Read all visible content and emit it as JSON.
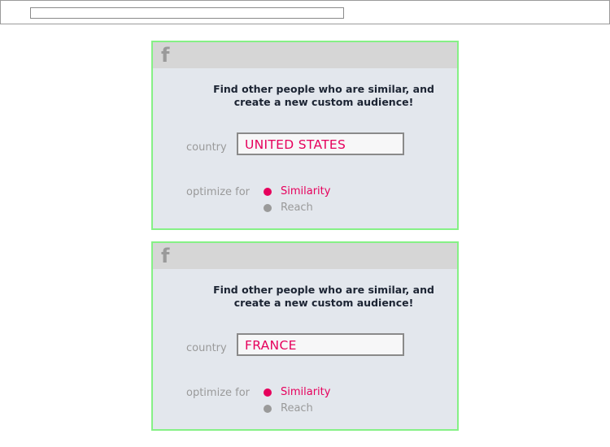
{
  "colors": {
    "accent": "#e6005c",
    "muted": "#9a9a9a",
    "card_border": "#86f086",
    "card_bg": "#e3e7ed"
  },
  "cards": [
    {
      "icon": "facebook-icon",
      "icon_glyph": "f",
      "headline_line1": "Find other people who are similar, and",
      "headline_line2": "create a new custom audience!",
      "country_label": "country",
      "country_value": "UNITED STATES",
      "optimize_label": "optimize for",
      "options": [
        {
          "label": "Similarity",
          "selected": true
        },
        {
          "label": "Reach",
          "selected": false
        }
      ]
    },
    {
      "icon": "facebook-icon",
      "icon_glyph": "f",
      "headline_line1": "Find other people who are similar, and",
      "headline_line2": "create a new custom audience!",
      "country_label": "country",
      "country_value": "FRANCE",
      "optimize_label": "optimize for",
      "options": [
        {
          "label": "Similarity",
          "selected": true
        },
        {
          "label": "Reach",
          "selected": false
        }
      ]
    }
  ]
}
